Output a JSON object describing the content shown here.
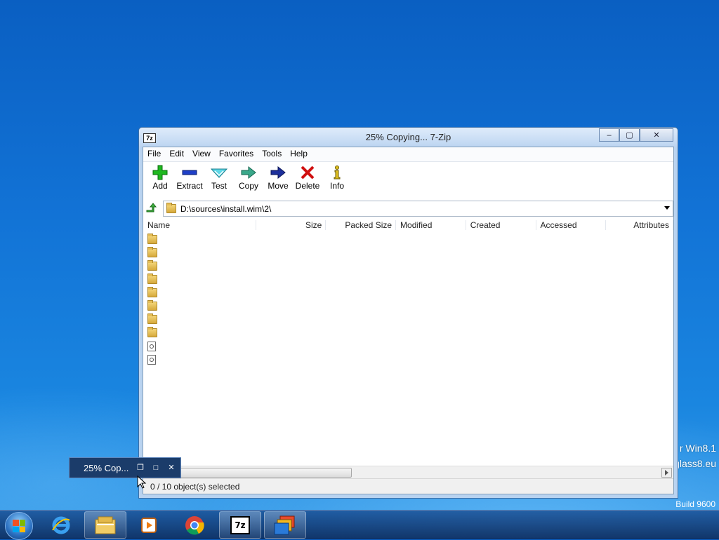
{
  "window": {
    "title": "25% Copying... 7-Zip",
    "app_icon_text": "7z",
    "minimize": "–",
    "maximize": "▢",
    "close": "✕"
  },
  "menu": [
    {
      "label": "File"
    },
    {
      "label": "Edit"
    },
    {
      "label": "View"
    },
    {
      "label": "Favorites"
    },
    {
      "label": "Tools"
    },
    {
      "label": "Help"
    }
  ],
  "toolbar": [
    {
      "label": "Add",
      "icon": "add-icon"
    },
    {
      "label": "Extract",
      "icon": "extract-icon"
    },
    {
      "label": "Test",
      "icon": "test-icon"
    },
    {
      "label": "Copy",
      "icon": "copy-icon"
    },
    {
      "label": "Move",
      "icon": "move-icon"
    },
    {
      "label": "Delete",
      "icon": "delete-icon"
    },
    {
      "label": "Info",
      "icon": "info-icon"
    }
  ],
  "address": {
    "path": "D:\\sources\\install.wim\\2\\"
  },
  "columns": [
    "Name",
    "Size",
    "Packed Size",
    "Modified",
    "Created",
    "Accessed",
    "Attributes"
  ],
  "rows": [
    {
      "type": "folder"
    },
    {
      "type": "folder"
    },
    {
      "type": "folder"
    },
    {
      "type": "folder"
    },
    {
      "type": "folder"
    },
    {
      "type": "folder"
    },
    {
      "type": "folder"
    },
    {
      "type": "folder"
    },
    {
      "type": "file"
    },
    {
      "type": "file"
    }
  ],
  "status": "0 / 10 object(s) selected",
  "progress_mini": {
    "title": "25% Cop..."
  },
  "desktop": {
    "watermark1": "r Win8.1",
    "watermark2": "glass8.eu",
    "build": "Build 9600"
  },
  "colors": {
    "accent": "#1b3c6a",
    "titlebar": "#bdd5f1"
  }
}
